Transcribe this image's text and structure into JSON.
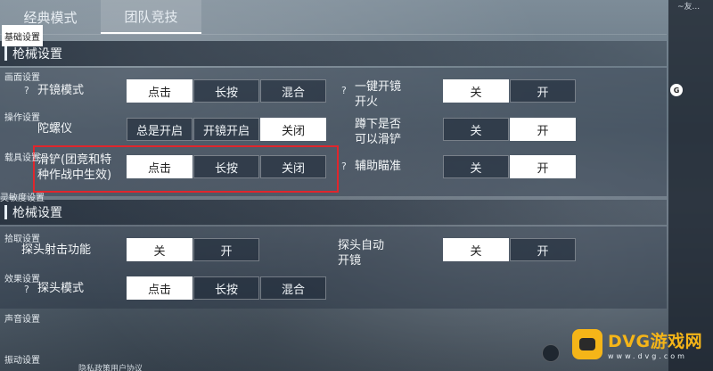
{
  "tabs": [
    "经典模式",
    "团队竞技"
  ],
  "sections": {
    "weapon1_title": "枪械设置",
    "weapon2_title": "枪械设置"
  },
  "help_mark": "?",
  "rows": {
    "scope_mode": {
      "label": "开镜模式",
      "options": [
        "点击",
        "长按",
        "混合"
      ],
      "selected": "点击"
    },
    "one_key_fire": {
      "label": "一键开镜开火",
      "options": [
        "关",
        "开"
      ],
      "selected": "关"
    },
    "gyroscope": {
      "label": "陀螺仪",
      "options": [
        "总是开启",
        "开镜开启",
        "关闭"
      ],
      "selected": "关闭"
    },
    "crouch_slide": {
      "label": "蹲下是否可以滑铲",
      "options": [
        "关",
        "开"
      ],
      "selected": "开"
    },
    "slide": {
      "label": "滑铲(团竞和特种作战中生效)",
      "options": [
        "点击",
        "长按",
        "关闭"
      ],
      "selected": "点击"
    },
    "aim_assist": {
      "label": "辅助瞄准",
      "options": [
        "关",
        "开"
      ],
      "selected": "开"
    },
    "peek_fire": {
      "label": "探头射击功能",
      "options": [
        "关",
        "开"
      ],
      "selected": "关"
    },
    "peek_auto_scope": {
      "label": "探头自动开镜",
      "options": [
        "关",
        "开"
      ],
      "selected": "关"
    },
    "peek_mode": {
      "label": "探头模式",
      "options": [
        "点击",
        "长按",
        "混合"
      ],
      "selected": "点击"
    }
  },
  "sidebar": {
    "items": [
      "基础设置",
      "画面设置",
      "操作设置",
      "载具设置",
      "灵敏度设置",
      "拾取设置",
      "效果设置",
      "声音设置",
      "振动设置"
    ],
    "badge": "G",
    "top_text": "~友..."
  },
  "footer": {
    "text": "隐私政策用户协议"
  },
  "watermark": {
    "brand": "DVG游戏网",
    "domain": "www.dvg.com"
  },
  "colors": {
    "selected_bg": "#ffffff",
    "highlight": "#e0262c",
    "watermark": "#f5b518"
  }
}
